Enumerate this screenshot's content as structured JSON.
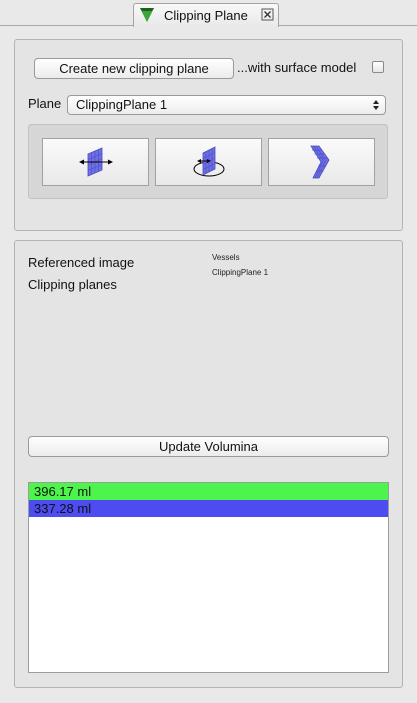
{
  "tab": {
    "title": "Clipping Plane",
    "icon": "clipping-plane-icon",
    "close_icon": "close-icon"
  },
  "controls": {
    "create_button_label": "Create new clipping plane",
    "surface_model_label": "...with surface model",
    "surface_model_checked": false,
    "plane_label": "Plane",
    "plane_selected": "ClippingPlane 1"
  },
  "tools": [
    {
      "icon": "translate-plane-icon"
    },
    {
      "icon": "rotate-plane-icon"
    },
    {
      "icon": "deform-plane-icon"
    }
  ],
  "info": {
    "referenced_image_label": "Referenced image",
    "referenced_image_value": "Vessels",
    "clipping_planes_label": "Clipping planes",
    "clipping_planes_value": "ClippingPlane 1"
  },
  "update_button_label": "Update Volumina",
  "volumes": [
    {
      "value": "396.17 ml",
      "color": "#4cf44c"
    },
    {
      "value": "337.28 ml",
      "color": "#4c4cf0"
    }
  ],
  "colors": {
    "plane_blue": "#6a6ae0",
    "background": "#e9e9e9"
  }
}
